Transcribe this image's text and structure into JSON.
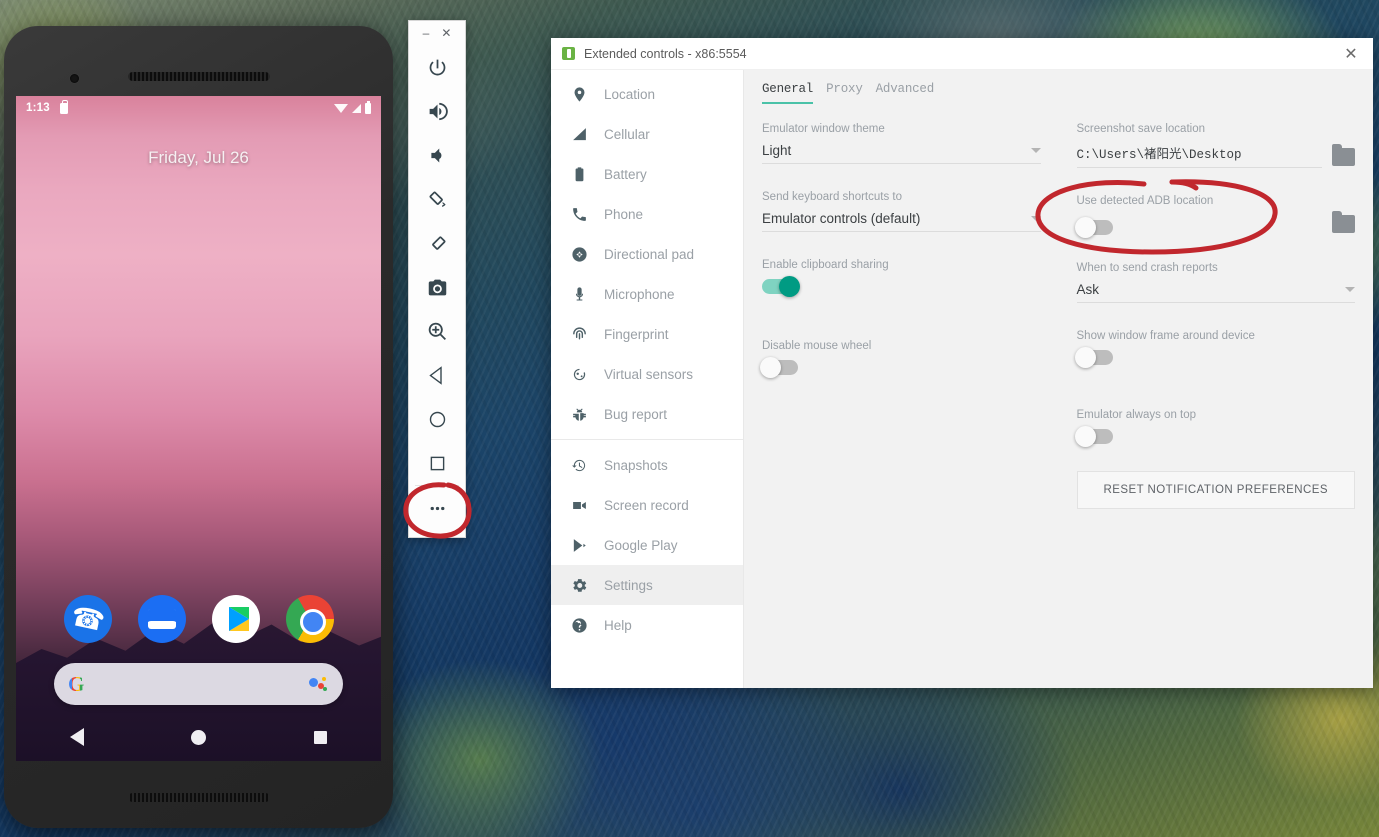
{
  "wallpaper": {
    "description": "aerial-river-forest-photo"
  },
  "phone": {
    "status_bar": {
      "time": "1:13",
      "lock_icon": "lock-icon",
      "wifi_icon": "wifi-icon",
      "signal_icon": "signal-icon",
      "battery_icon": "battery-icon"
    },
    "date_text": "Friday, Jul 26",
    "dock": [
      {
        "name": "phone-app-icon",
        "label": "Phone"
      },
      {
        "name": "messages-app-icon",
        "label": "Messages"
      },
      {
        "name": "play-store-app-icon",
        "label": "Play Store"
      },
      {
        "name": "chrome-app-icon",
        "label": "Chrome"
      }
    ],
    "search_bar": {
      "logo": "google-logo",
      "assistant_icon": "google-assistant-icon"
    },
    "nav_bar": [
      {
        "name": "nav-back-button",
        "label": "Back"
      },
      {
        "name": "nav-home-button",
        "label": "Home"
      },
      {
        "name": "nav-recents-button",
        "label": "Recents"
      }
    ]
  },
  "toolbar": {
    "window_minimize": "–",
    "window_close": "✕",
    "buttons": [
      {
        "name": "power-button",
        "icon": "power-icon"
      },
      {
        "name": "volume-up-button",
        "icon": "volume-up-icon"
      },
      {
        "name": "volume-down-button",
        "icon": "volume-down-icon"
      },
      {
        "name": "rotate-left-button",
        "icon": "rotate-left-icon"
      },
      {
        "name": "rotate-right-button",
        "icon": "rotate-right-icon"
      },
      {
        "name": "screenshot-button",
        "icon": "camera-icon"
      },
      {
        "name": "zoom-button",
        "icon": "zoom-in-icon"
      },
      {
        "name": "back-button",
        "icon": "triangle-back-icon"
      },
      {
        "name": "home-button",
        "icon": "circle-home-icon"
      },
      {
        "name": "overview-button",
        "icon": "square-overview-icon"
      },
      {
        "name": "more-button",
        "icon": "ellipsis-icon"
      }
    ]
  },
  "extended_controls": {
    "title": "Extended controls - x86:5554",
    "app_icon": "android-emulator-icon",
    "close_icon": "close-icon",
    "sidebar": [
      {
        "label": "Location",
        "icon": "location-pin-icon",
        "active": false
      },
      {
        "label": "Cellular",
        "icon": "cellular-signal-icon",
        "active": false
      },
      {
        "label": "Battery",
        "icon": "battery-icon",
        "active": false
      },
      {
        "label": "Phone",
        "icon": "phone-handset-icon",
        "active": false
      },
      {
        "label": "Directional pad",
        "icon": "dpad-icon",
        "active": false
      },
      {
        "label": "Microphone",
        "icon": "microphone-icon",
        "active": false
      },
      {
        "label": "Fingerprint",
        "icon": "fingerprint-icon",
        "active": false
      },
      {
        "label": "Virtual sensors",
        "icon": "virtual-sensors-icon",
        "active": false
      },
      {
        "label": "Bug report",
        "icon": "bug-icon",
        "active": false
      },
      {
        "label": "Snapshots",
        "icon": "history-clock-icon",
        "active": false
      },
      {
        "label": "Screen record",
        "icon": "video-camera-icon",
        "active": false
      },
      {
        "label": "Google Play",
        "icon": "google-play-icon",
        "active": false
      },
      {
        "label": "Settings",
        "icon": "gear-icon",
        "active": true
      },
      {
        "label": "Help",
        "icon": "help-question-icon",
        "active": false
      }
    ],
    "tabs": [
      {
        "label": "General",
        "active": true
      },
      {
        "label": "Proxy",
        "active": false
      },
      {
        "label": "Advanced",
        "active": false
      }
    ],
    "settings": {
      "emulator_window_theme": {
        "label": "Emulator window theme",
        "value": "Light"
      },
      "screenshot_save_location": {
        "label": "Screenshot save location",
        "value": "C:\\Users\\褚阳光\\Desktop",
        "folder_icon": "folder-icon"
      },
      "send_keyboard_shortcuts_to": {
        "label": "Send keyboard shortcuts to",
        "value": "Emulator controls (default)"
      },
      "use_detected_adb_location": {
        "label": "Use detected ADB location",
        "value": "off",
        "folder_icon": "folder-icon"
      },
      "enable_clipboard_sharing": {
        "label": "Enable clipboard sharing",
        "value": "on"
      },
      "when_to_send_crash_reports": {
        "label": "When to send crash reports",
        "value": "Ask"
      },
      "disable_mouse_wheel": {
        "label": "Disable mouse wheel",
        "value": "off"
      },
      "show_window_frame_around_device": {
        "label": "Show window frame around device",
        "value": "off"
      },
      "emulator_always_on_top": {
        "label": "Emulator always on top",
        "value": "off"
      },
      "reset_notification_preferences": {
        "label": "RESET NOTIFICATION PREFERENCES"
      }
    }
  },
  "annotations": {
    "color": "#c1272d",
    "items": [
      {
        "name": "annotation-circle-adb-toggle",
        "target": "Use detected ADB location"
      },
      {
        "name": "annotation-circle-more-button",
        "target": "more-button"
      }
    ]
  }
}
